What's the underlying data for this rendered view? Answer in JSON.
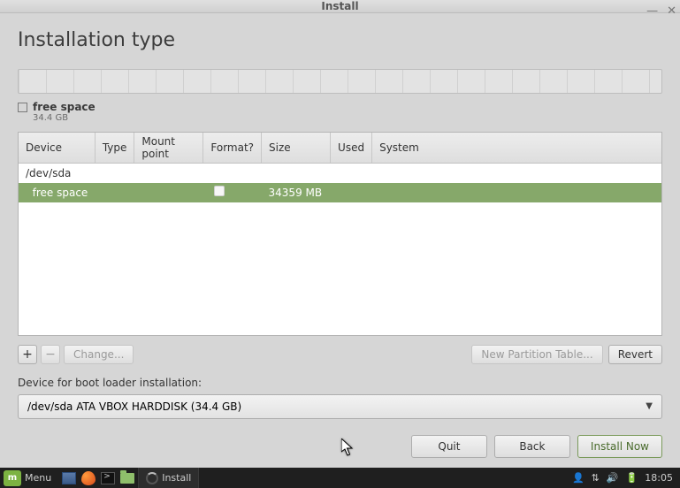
{
  "window": {
    "title": "Install"
  },
  "page": {
    "heading": "Installation type"
  },
  "legend": {
    "label": "free space",
    "size": "34.4 GB"
  },
  "columns": {
    "device": "Device",
    "type": "Type",
    "mount": "Mount point",
    "format": "Format?",
    "size": "Size",
    "used": "Used",
    "system": "System"
  },
  "rows": {
    "disk": {
      "device": "/dev/sda"
    },
    "free": {
      "device": "  free space",
      "size": "34359 MB"
    }
  },
  "toolbar": {
    "add": "+",
    "remove": "−",
    "change": "Change...",
    "newtable": "New Partition Table...",
    "revert": "Revert"
  },
  "bootloader": {
    "label": "Device for boot loader installation:",
    "value": "/dev/sda  ATA VBOX HARDDISK (34.4 GB)"
  },
  "footer": {
    "quit": "Quit",
    "back": "Back",
    "install": "Install Now"
  },
  "taskbar": {
    "menu": "Menu",
    "app": "Install",
    "clock": "18:05"
  }
}
